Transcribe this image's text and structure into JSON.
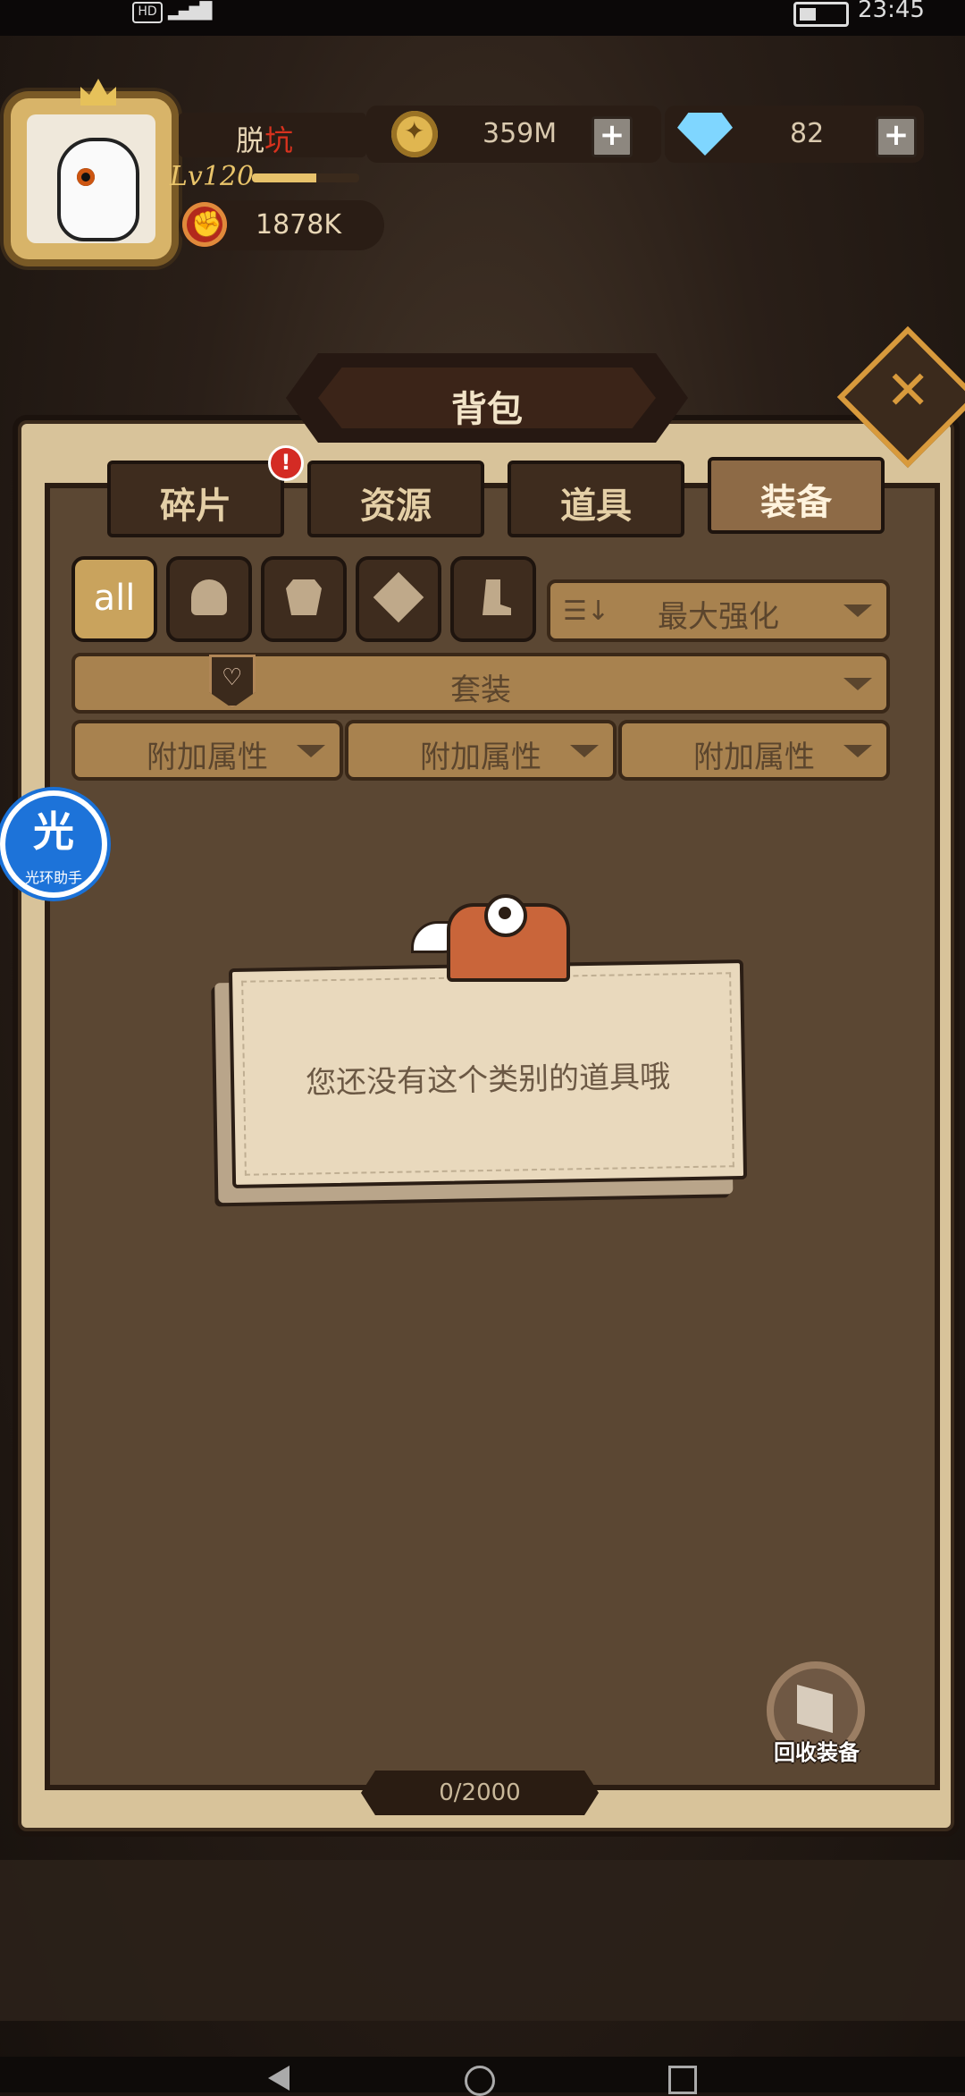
{
  "status_bar": {
    "time": "23:45",
    "hd": "HD",
    "signal": "4G"
  },
  "player": {
    "name_prefix": "脱",
    "name_highlight": "坑",
    "level": "Lv120",
    "power": "1878K"
  },
  "currency": {
    "gold": "359M",
    "gems": "82",
    "plus": "+"
  },
  "panel": {
    "title": "背包",
    "close": "✕",
    "tabs": [
      {
        "label": "碎片"
      },
      {
        "label": "资源"
      },
      {
        "label": "道具"
      },
      {
        "label": "装备"
      }
    ],
    "badge": "!"
  },
  "filters": {
    "all_label": "all",
    "sort_label": "最大强化",
    "set_label": "套装",
    "attr_labels": [
      "附加属性",
      "附加属性",
      "附加属性"
    ]
  },
  "empty_state": {
    "message": "您还没有这个类别的道具哦"
  },
  "recycle": {
    "label": "回收装备"
  },
  "counter": "0/2000",
  "helper": {
    "glyph": "光",
    "label": "光环助手"
  },
  "colors": {
    "accent": "#d89a3c",
    "badge": "#d42b24",
    "helper_blue": "#1d73d9"
  }
}
